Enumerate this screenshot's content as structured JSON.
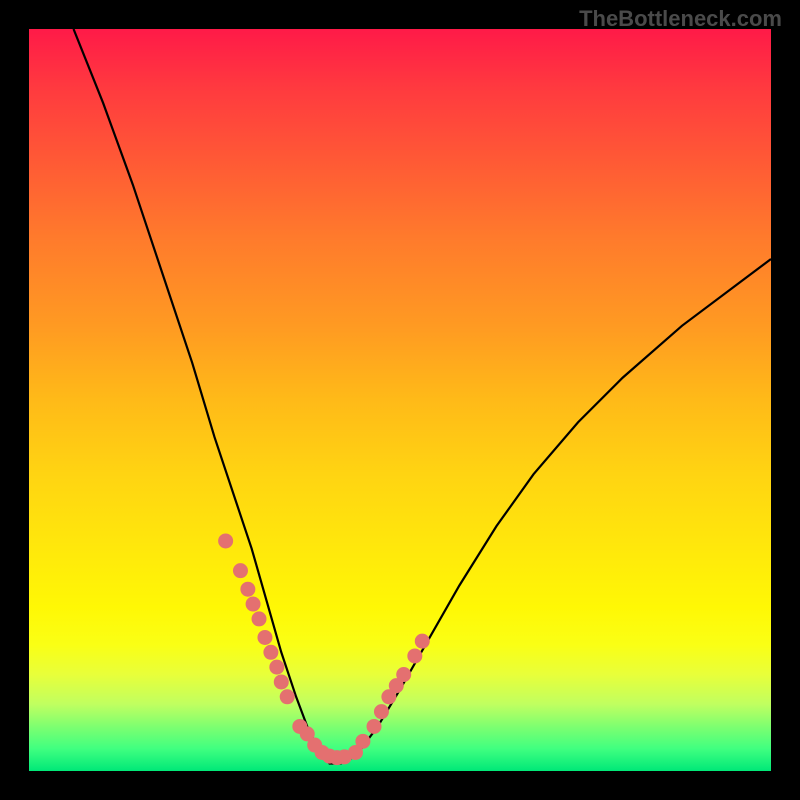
{
  "watermark_text": "TheBottleneck.com",
  "chart_data": {
    "type": "line",
    "title": "",
    "xlabel": "",
    "ylabel": "",
    "axes_visible": false,
    "ylim": [
      0,
      100
    ],
    "xlim": [
      0,
      100
    ],
    "background": "rainbow-gradient red-top green-bottom",
    "series": [
      {
        "name": "bottleneck-curve",
        "type": "line",
        "color": "#000000",
        "x": [
          6,
          10,
          14,
          18,
          22,
          25,
          28,
          30,
          32,
          34,
          36,
          37.5,
          39,
          40.5,
          42,
          44,
          47,
          50,
          54,
          58,
          63,
          68,
          74,
          80,
          88,
          96,
          100
        ],
        "y": [
          100,
          90,
          79,
          67,
          55,
          45,
          36,
          30,
          23,
          16,
          10,
          6,
          3,
          1,
          1,
          2,
          6,
          11,
          18,
          25,
          33,
          40,
          47,
          53,
          60,
          66,
          69
        ]
      }
    ],
    "scatter_overlay": {
      "name": "highlighted-points",
      "type": "scatter",
      "color": "#e47070",
      "size": 15,
      "x_extent": [
        26,
        54
      ],
      "x": [
        26.5,
        28.5,
        29.5,
        30.2,
        31.0,
        31.8,
        32.6,
        33.4,
        34.0,
        34.8,
        36.5,
        37.5,
        38.5,
        39.5,
        40.5,
        41.5,
        42.5,
        44.0,
        45.0,
        46.5,
        47.5,
        48.5,
        49.5,
        50.5,
        52.0,
        53.0
      ],
      "y": [
        31,
        27,
        24.5,
        22.5,
        20.5,
        18,
        16,
        14,
        12,
        10,
        6,
        5,
        3.5,
        2.5,
        2,
        1.8,
        1.9,
        2.5,
        4,
        6,
        8,
        10,
        11.5,
        13,
        15.5,
        17.5
      ]
    }
  }
}
